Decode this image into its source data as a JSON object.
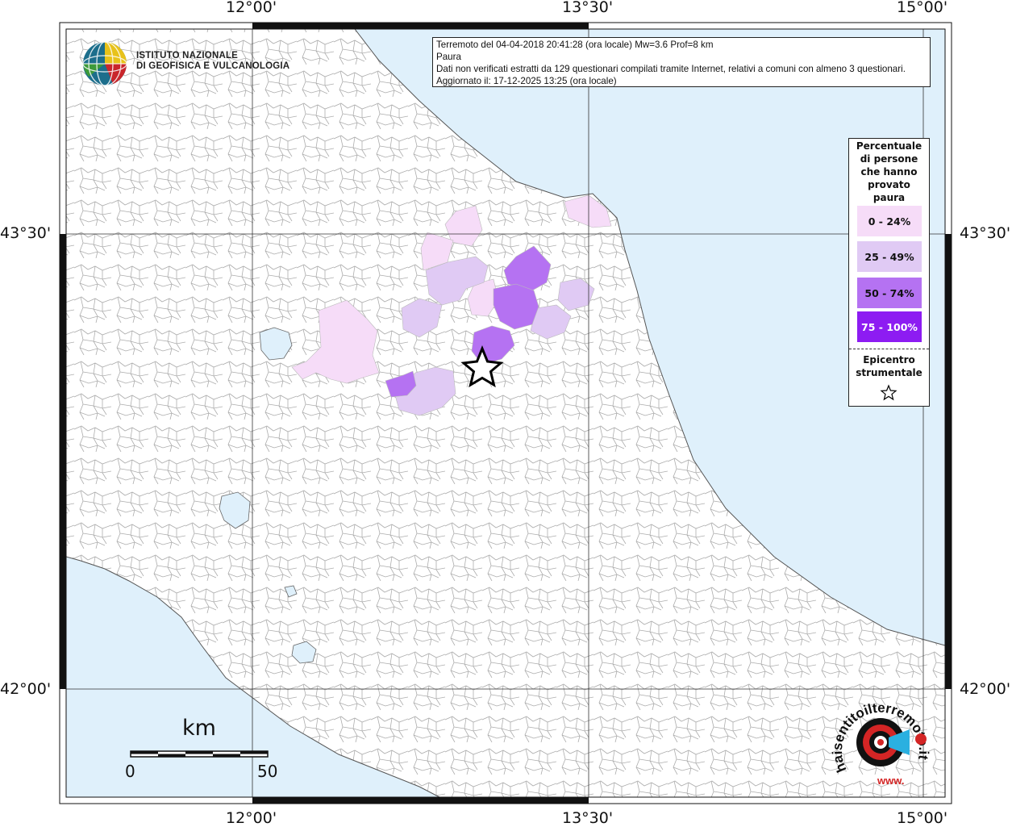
{
  "map": {
    "coordinate_labels": {
      "lon": [
        "12°00'",
        "13°30'",
        "15°00'"
      ],
      "lat": [
        "43°30'",
        "42°00'"
      ]
    },
    "colors": {
      "sea": "#dff0fb",
      "land": "#ffffff",
      "border": "#9a9a9a",
      "frame": "#111111",
      "class_0_24": "#f6dcf8",
      "class_25_49": "#e0caf4",
      "class_50_74": "#b572f2",
      "class_75_100": "#8d1cf2"
    }
  },
  "info": {
    "line1": "Terremoto del 04-04-2018 20:41:28 (ora locale) Mw=3.6 Prof=8 km",
    "line2": "Paura",
    "line3": "Dati non verificati estratti da 129 questionari compilati tramite Internet, relativi a comuni con almeno 3 questionari.",
    "line4": "Aggiornato il: 17-12-2025 13:25 (ora locale)"
  },
  "logo": {
    "line1": "ISTITUTO NAZIONALE",
    "line2": "DI GEOFISICA E VULCANOLOGIA"
  },
  "legend": {
    "title_lines": [
      "Percentuale",
      "di persone",
      "che hanno",
      "provato",
      "paura"
    ],
    "items": [
      {
        "label": "0 - 24%",
        "color": "#f6dcf8",
        "text_color": "#111111"
      },
      {
        "label": "25 - 49%",
        "color": "#e0caf4",
        "text_color": "#111111"
      },
      {
        "label": "50 - 74%",
        "color": "#b572f2",
        "text_color": "#111111"
      },
      {
        "label": "75 - 100%",
        "color": "#8d1cf2",
        "text_color": "#ffffff"
      }
    ],
    "epicenter_lines": [
      "Epicentro",
      "strumentale"
    ],
    "epicenter_icon": "star-outline-icon"
  },
  "scale": {
    "title": "km",
    "min_label": "0",
    "max_label": "50"
  },
  "hst_logo": {
    "text": "haisentitoilterremoto.it",
    "url_text": "www."
  }
}
